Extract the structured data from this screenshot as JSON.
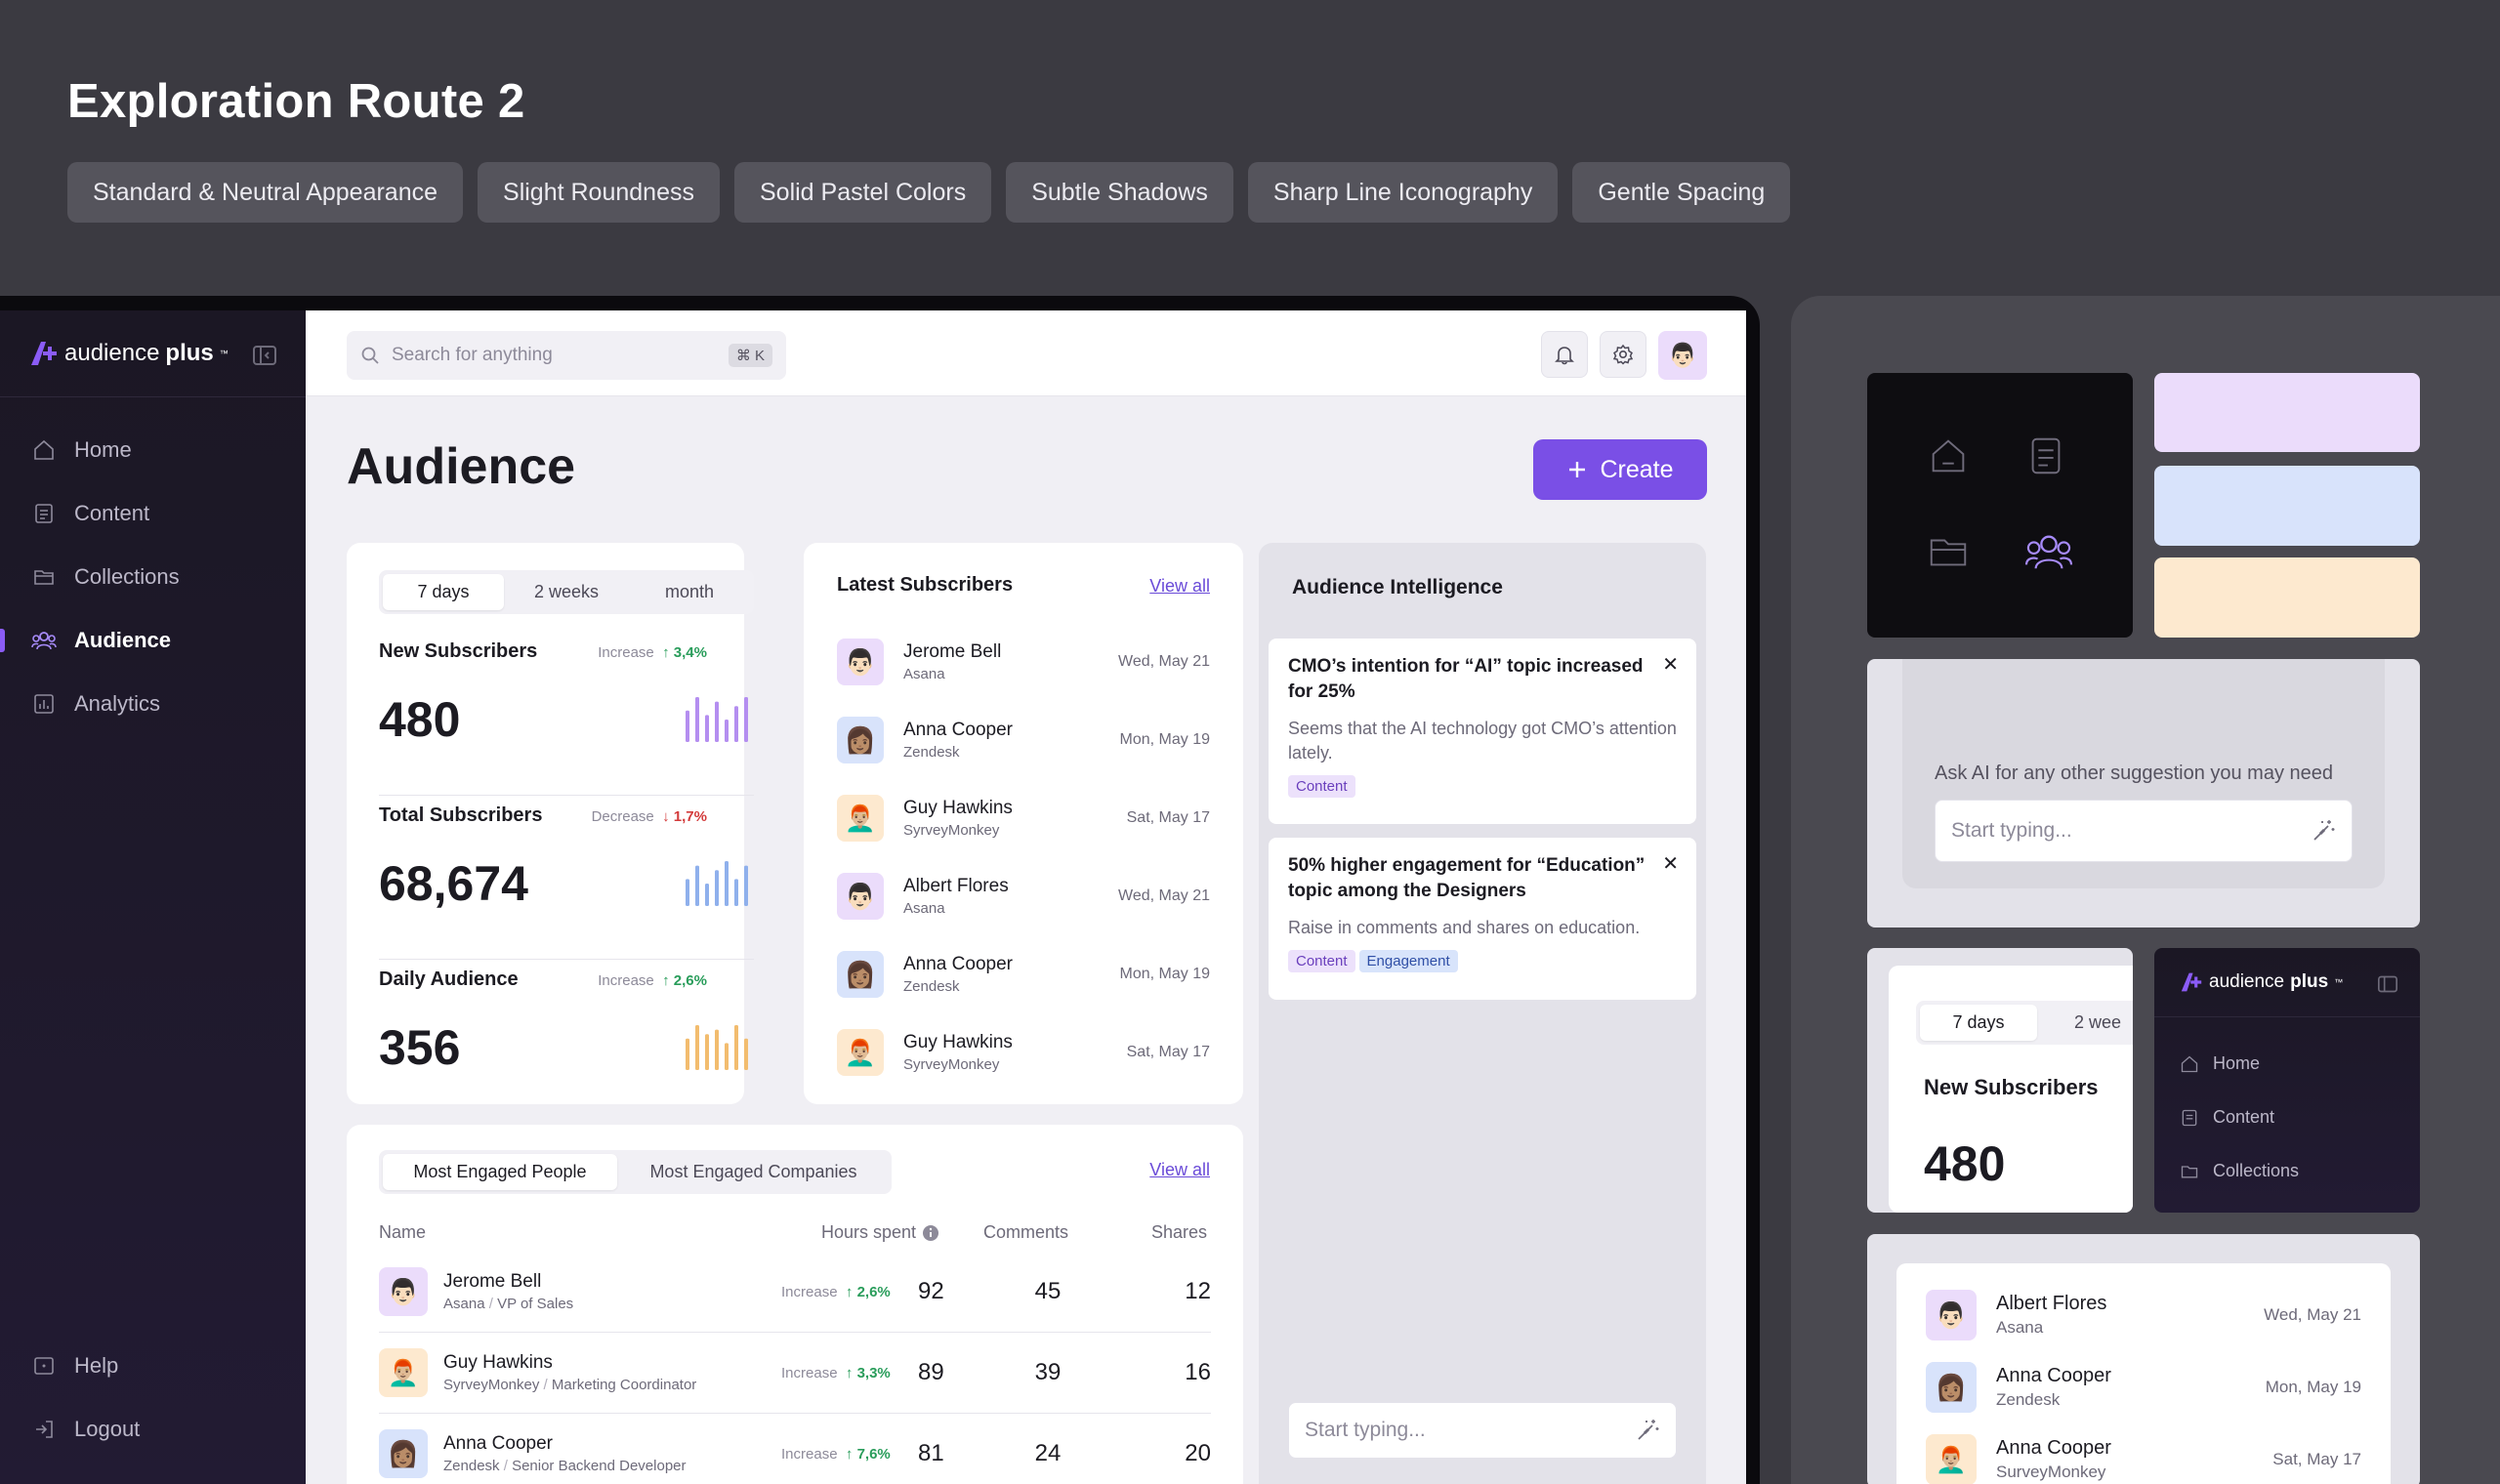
{
  "header": {
    "title": "Exploration Route 2",
    "chips": [
      "Standard & Neutral Appearance",
      "Slight Roundness",
      "Solid Pastel Colors",
      "Subtle Shadows",
      "Sharp Line Iconography",
      "Gentle Spacing"
    ]
  },
  "colors": {
    "accent": "#7a4fe6",
    "purple_pastel": "#ebdcfb",
    "blue_pastel": "#d8e3fb",
    "peach_pastel": "#fde9cf"
  },
  "brand": {
    "name_light": "audience",
    "name_bold": "plus",
    "tm": "™"
  },
  "sidebar": {
    "items": [
      {
        "label": "Home",
        "icon": "home-icon"
      },
      {
        "label": "Content",
        "icon": "document-icon"
      },
      {
        "label": "Collections",
        "icon": "folder-icon"
      },
      {
        "label": "Audience",
        "icon": "users-icon",
        "active": true
      },
      {
        "label": "Analytics",
        "icon": "chart-icon"
      }
    ],
    "bottom": [
      {
        "label": "Help",
        "icon": "help-icon"
      },
      {
        "label": "Logout",
        "icon": "logout-icon"
      }
    ]
  },
  "topbar": {
    "search_placeholder": "Search for anything",
    "shortcut": "⌘ K"
  },
  "page": {
    "title": "Audience",
    "create_label": "Create"
  },
  "stats": {
    "periods": [
      "7 days",
      "2 weeks",
      "month"
    ],
    "items": [
      {
        "label": "New Subscribers",
        "trend_label": "Increase",
        "trend": "3,4%",
        "direction": "up",
        "value": "480",
        "bars": [
          0.7,
          1,
          0.6,
          0.9,
          0.5,
          0.8,
          1
        ]
      },
      {
        "label": "Total Subscribers",
        "trend_label": "Decrease",
        "trend": "1,7%",
        "direction": "down",
        "value": "68,674",
        "bars": [
          0.6,
          0.9,
          0.5,
          0.8,
          1,
          0.6,
          0.9
        ]
      },
      {
        "label": "Daily Audience",
        "trend_label": "Increase",
        "trend": "2,6%",
        "direction": "up",
        "value": "356",
        "bars": [
          0.7,
          1,
          0.8,
          0.9,
          0.6,
          1,
          0.7
        ]
      }
    ]
  },
  "latest": {
    "title": "Latest Subscribers",
    "view_all": "View all",
    "rows": [
      {
        "name": "Jerome Bell",
        "company": "Asana",
        "date": "Wed, May 21",
        "emoji": "👨🏻",
        "bg": "#ebdcfb"
      },
      {
        "name": "Anna Cooper",
        "company": "Zendesk",
        "date": "Mon, May 19",
        "emoji": "👩🏽",
        "bg": "#d8e3fb"
      },
      {
        "name": "Guy Hawkins",
        "company": "SyrveyMonkey",
        "date": "Sat, May 17",
        "emoji": "👨🏼‍🦰",
        "bg": "#fde9cf"
      },
      {
        "name": "Albert Flores",
        "company": "Asana",
        "date": "Wed, May 21",
        "emoji": "👨🏻",
        "bg": "#ebdcfb"
      },
      {
        "name": "Anna Cooper",
        "company": "Zendesk",
        "date": "Mon, May 19",
        "emoji": "👩🏽",
        "bg": "#d8e3fb"
      },
      {
        "name": "Guy Hawkins",
        "company": "SyrveyMonkey",
        "date": "Sat, May 17",
        "emoji": "👨🏼‍🦰",
        "bg": "#fde9cf"
      }
    ]
  },
  "ai": {
    "title": "Audience Intelligence",
    "cards": [
      {
        "title": "CMO’s intention for “AI” topic increased for 25%",
        "body": "Seems that the AI technology got CMO’s attention lately.",
        "tags": [
          "Content"
        ]
      },
      {
        "title": "50% higher engagement for “Education” topic among the Designers",
        "body": "Raise in comments and shares on education.",
        "tags": [
          "Content",
          "Engagement"
        ]
      }
    ],
    "input_placeholder": "Start typing..."
  },
  "engaged": {
    "tabs": [
      "Most Engaged People",
      "Most Engaged Companies"
    ],
    "view_all": "View all",
    "columns": [
      "Name",
      "Hours spent",
      "Comments",
      "Shares"
    ],
    "rows": [
      {
        "name": "Jerome Bell",
        "company": "Asana",
        "role": "VP of Sales",
        "trend_label": "Increase",
        "trend": "2,6%",
        "hours": "92",
        "comments": "45",
        "shares": "12",
        "emoji": "👨🏻",
        "bg": "#ebdcfb"
      },
      {
        "name": "Guy Hawkins",
        "company": "SyrveyMonkey",
        "role": "Marketing Coordinator",
        "trend_label": "Increase",
        "trend": "3,3%",
        "hours": "89",
        "comments": "39",
        "shares": "16",
        "emoji": "👨🏼‍🦰",
        "bg": "#fde9cf"
      },
      {
        "name": "Anna Cooper",
        "company": "Zendesk",
        "role": "Senior Backend Developer",
        "trend_label": "Increase",
        "trend": "7,6%",
        "hours": "81",
        "comments": "24",
        "shares": "20",
        "emoji": "👩🏽",
        "bg": "#d8e3fb"
      }
    ]
  },
  "preview": {
    "ai_prompt": "Ask AI for any other suggestion you may need",
    "input_placeholder": "Start typing...",
    "mini_periods": [
      "7 days",
      "2 wee"
    ],
    "mini_stat_label": "New Subscribers",
    "mini_stat_value": "480",
    "mini_nav": [
      "Home",
      "Content",
      "Collections"
    ],
    "list": [
      {
        "name": "Albert Flores",
        "company": "Asana",
        "date": "Wed, May 21",
        "emoji": "👨🏻",
        "bg": "#ebdcfb"
      },
      {
        "name": "Anna Cooper",
        "company": "Zendesk",
        "date": "Mon, May 19",
        "emoji": "👩🏽",
        "bg": "#d8e3fb"
      },
      {
        "name": "Anna Cooper",
        "company": "SurveyMonkey",
        "date": "Sat, May 17",
        "emoji": "👨🏼‍🦰",
        "bg": "#fde9cf"
      }
    ]
  }
}
